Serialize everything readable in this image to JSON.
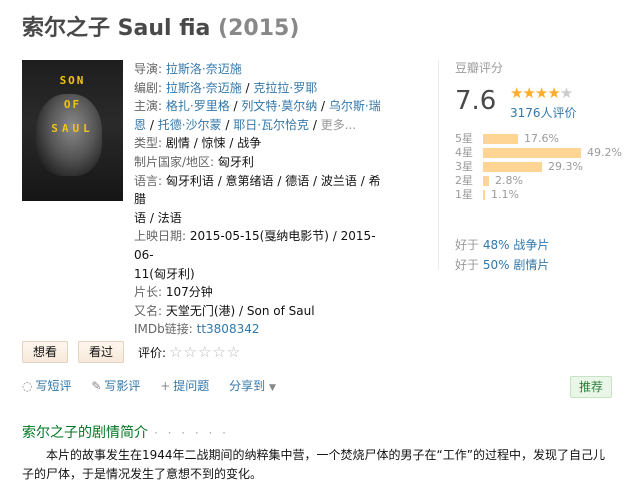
{
  "title": {
    "name": "索尔之子 Saul fia",
    "year": "(2015)"
  },
  "poster": {
    "lines": [
      "SON",
      "OF",
      "SAUL"
    ]
  },
  "info": {
    "director": {
      "label": "导演",
      "value": "拉斯洛·奈迈施"
    },
    "writers": {
      "label": "编剧",
      "values": [
        "拉斯洛·奈迈施",
        "克拉拉·罗耶"
      ]
    },
    "cast": {
      "label": "主演",
      "line1": [
        "格扎·罗里格",
        "列文特·莫尔纳",
        "乌尔斯·瑞"
      ],
      "line2": [
        "恩",
        "托德·沙尔蒙",
        "耶日·瓦尔恰克"
      ],
      "more": "更多..."
    },
    "genre": {
      "label": "类型",
      "values": "剧情 / 惊悚 / 战争"
    },
    "country": {
      "label": "制片国家/地区",
      "value": "匈牙利"
    },
    "language": {
      "label": "语言",
      "line1": "匈牙利语 / 意第绪语 / 德语 / 波兰语 / 希腊",
      "line2": "语 / 法语"
    },
    "release": {
      "label": "上映日期",
      "line1": "2015-05-15(戛纳电影节) / 2015-06-",
      "line2": "11(匈牙利)"
    },
    "runtime": {
      "label": "片长",
      "value": "107分钟"
    },
    "aka": {
      "label": "又名",
      "value": "天堂无门(港) / Son of Saul"
    },
    "imdb": {
      "label": "IMDb链接",
      "value": "tt3808342"
    }
  },
  "rating": {
    "label": "豆瓣评分",
    "score": "7.6",
    "stars_full": "★★★★",
    "stars_empty": "★",
    "votes": "3176人评价",
    "distribution": [
      {
        "label": "5星",
        "pct": "17.6%",
        "value": 17.6
      },
      {
        "label": "4星",
        "pct": "49.2%",
        "value": 49.2
      },
      {
        "label": "3星",
        "pct": "29.3%",
        "value": 29.3
      },
      {
        "label": "2星",
        "pct": "2.8%",
        "value": 2.8
      },
      {
        "label": "1星",
        "pct": "1.1%",
        "value": 1.1
      }
    ],
    "better_than": [
      {
        "prefix": "好于",
        "link": "48% 战争片"
      },
      {
        "prefix": "好于",
        "link": "50% 剧情片"
      }
    ]
  },
  "actions": {
    "want": "想看",
    "seen": "看过",
    "rate_label": "评价:",
    "rate_stars": "☆☆☆☆☆"
  },
  "social": {
    "short_review": "写短评",
    "review": "写影评",
    "question": "提问题",
    "share": "分享到",
    "recommend": "推荐"
  },
  "synopsis": {
    "title": "索尔之子的剧情简介",
    "dots": "· · · · · ·",
    "text": "本片的故事发生在1944年二战期间的纳粹集中营，一个焚烧尸体的男子在“工作”的过程中，发现了自己儿子的尸体，于是情况发生了意想不到的变化。"
  },
  "colors": {
    "link": "#3377aa",
    "green_title": "#007722",
    "star": "#ffac2d",
    "bar": "#ffd596"
  }
}
